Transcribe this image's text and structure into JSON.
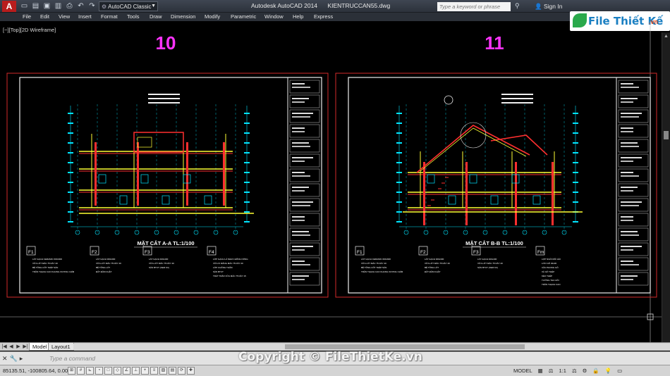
{
  "app": {
    "title": "Autodesk AutoCAD 2014",
    "filename": "KIENTRUCCAN55.dwg",
    "logo_letter": "A",
    "workspace": "AutoCAD Classic",
    "search_placeholder": "Type a keyword or phrase",
    "signin": "Sign In"
  },
  "menu": [
    "File",
    "Edit",
    "View",
    "Insert",
    "Format",
    "Tools",
    "Draw",
    "Dimension",
    "Modify",
    "Parametric",
    "Window",
    "Help",
    "Express"
  ],
  "viewport_label": "[−][Top][2D Wireframe]",
  "watermark_logo": {
    "text": "File Thiết Kế",
    "suffix": ".vn"
  },
  "sheets": [
    {
      "number": "10",
      "title": "MẶT CẮT A-A TL:1/100",
      "notes": [
        {
          "code": "F1",
          "lines": [
            "LÁT GẠCH CERAMIC 600x600",
            "VỮA LÓT MÁC 75 DÀY 20",
            "BÊ TÔNG CỐT THÉP SÀN",
            "TRẦN THẠCH CAO KHUNG XƯƠNG CHÌM"
          ]
        },
        {
          "code": "F2",
          "lines": [
            "LÁT GẠCH 300x300",
            "VỮA LÓT MÁC 75 DÀY 20",
            "BÊ TÔNG LÓT",
            "ĐẤT ĐẦM CHẶT"
          ]
        },
        {
          "code": "F3",
          "lines": [
            "LÁT GẠCH 400x400",
            "VỮA LÓT MÁC 75 DÀY 20",
            "SÀN BTCT (XEM KC)"
          ]
        },
        {
          "code": "F4",
          "lines": [
            "LỚP GẠCH LÁ NEM CHỐNG NÓNG",
            "VỮA XI MĂNG MÁC 75 DÀY 20",
            "LỚP CHỐNG THẤM",
            "SÀN BTCT",
            "TRÁT TRẦN VỮA MÁC 75 DÀY 15"
          ]
        }
      ]
    },
    {
      "number": "11",
      "title": "MẶT CẮT B-B TL:1/100",
      "notes": [
        {
          "code": "F1",
          "lines": [
            "LÁT GẠCH CERAMIC 600x600",
            "VỮA LÓT MÁC 75 DÀY 20",
            "BÊ TÔNG CỐT THÉP SÀN",
            "TRẦN THẠCH CAO KHUNG XƯƠNG CHÌM"
          ]
        },
        {
          "code": "F2",
          "lines": [
            "LÁT GẠCH 300x300",
            "VỮA LÓT MÁC 75 DÀY 20",
            "BÊ TÔNG LÓT",
            "ĐẤT ĐẦM CHẶT"
          ]
        },
        {
          "code": "F3",
          "lines": [
            "LÁT GẠCH 400x400",
            "VỮA LÓT MÁC 75 DÀY 20",
            "SÀN BTCT (XEM KC)"
          ]
        },
        {
          "code": "Fm",
          "lines": [
            "LỢP NGÓI MŨI HÀI",
            "LITO GỖ 30x30",
            "CẦU PHONG GỖ",
            "XÀ GỒ THÉP",
            "KÈO THÉP",
            "TƯỜNG THU HỒI",
            "TRẦN THẠCH CAO"
          ]
        }
      ]
    }
  ],
  "tabs": {
    "model": "Model",
    "layout": "Layout1"
  },
  "command_placeholder": "Type a command",
  "copyright": "Copyright © FileThietKe.vn",
  "coords": "85135.51, -100805.64, 0.00",
  "status": {
    "mode": "MODEL",
    "scale": "1:1"
  },
  "colors": {
    "background": "#000000",
    "sheet_border": "#d22a2a",
    "sheet_number": "#ff33ff",
    "dimension": "#00e5ff",
    "wall": "#ffff33",
    "section": "#ff2f2f",
    "text": "#ffffff"
  }
}
